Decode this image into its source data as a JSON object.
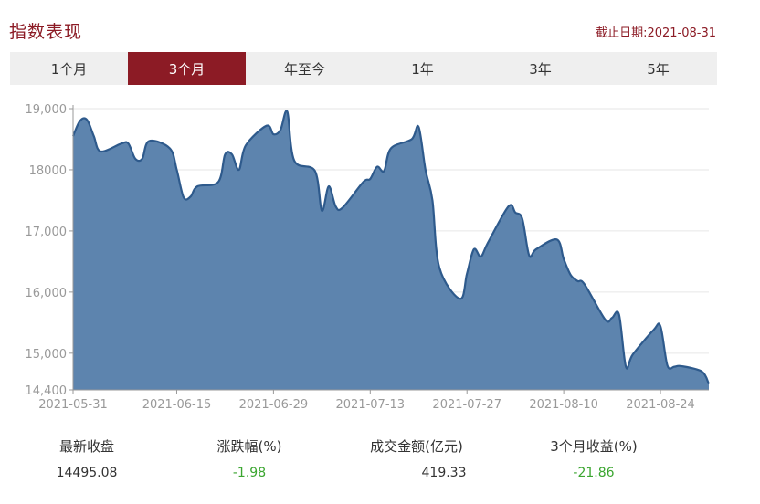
{
  "header": {
    "title": "指数表现",
    "as_of": "截止日期:2021-08-31"
  },
  "tabs": [
    {
      "label": "1个月",
      "active": false
    },
    {
      "label": "3个月",
      "active": true
    },
    {
      "label": "年至今",
      "active": false
    },
    {
      "label": "1年",
      "active": false
    },
    {
      "label": "3年",
      "active": false
    },
    {
      "label": "5年",
      "active": false
    }
  ],
  "chart_data": {
    "type": "area",
    "ylim": [
      14400,
      19000
    ],
    "yticks": [
      19000,
      18000,
      17000,
      16000,
      15000,
      14400
    ],
    "ytick_labels": [
      "19,000",
      "18000",
      "17,000",
      "16,000",
      "15,000",
      "14,400"
    ],
    "xlim": [
      "2021-05-31",
      "2021-08-31"
    ],
    "xticks": [
      "2021-05-31",
      "2021-06-15",
      "2021-06-29",
      "2021-07-13",
      "2021-07-27",
      "2021-08-10",
      "2021-08-24"
    ],
    "grid": true,
    "colors": {
      "line": "#2e5a8c",
      "fill": "#5d84ae",
      "grid": "#e6e6e6",
      "axis": "#999999",
      "label": "#999999"
    },
    "series": [
      {
        "points": [
          [
            "2021-05-31",
            18550
          ],
          [
            "2021-06-01",
            18800
          ],
          [
            "2021-06-02",
            18820
          ],
          [
            "2021-06-03",
            18550
          ],
          [
            "2021-06-04",
            18300
          ],
          [
            "2021-06-07",
            18430
          ],
          [
            "2021-06-08",
            18430
          ],
          [
            "2021-06-09",
            18180
          ],
          [
            "2021-06-10",
            18180
          ],
          [
            "2021-06-11",
            18470
          ],
          [
            "2021-06-14",
            18350
          ],
          [
            "2021-06-15",
            18000
          ],
          [
            "2021-06-16",
            17550
          ],
          [
            "2021-06-17",
            17560
          ],
          [
            "2021-06-18",
            17730
          ],
          [
            "2021-06-21",
            17800
          ],
          [
            "2021-06-22",
            18250
          ],
          [
            "2021-06-23",
            18250
          ],
          [
            "2021-06-24",
            18000
          ],
          [
            "2021-06-25",
            18400
          ],
          [
            "2021-06-28",
            18720
          ],
          [
            "2021-06-29",
            18580
          ],
          [
            "2021-06-30",
            18650
          ],
          [
            "2021-07-01",
            18950
          ],
          [
            "2021-07-02",
            18150
          ],
          [
            "2021-07-05",
            17980
          ],
          [
            "2021-07-06",
            17330
          ],
          [
            "2021-07-07",
            17730
          ],
          [
            "2021-07-08",
            17400
          ],
          [
            "2021-07-09",
            17380
          ],
          [
            "2021-07-12",
            17800
          ],
          [
            "2021-07-13",
            17850
          ],
          [
            "2021-07-14",
            18050
          ],
          [
            "2021-07-15",
            17980
          ],
          [
            "2021-07-16",
            18350
          ],
          [
            "2021-07-19",
            18500
          ],
          [
            "2021-07-20",
            18700
          ],
          [
            "2021-07-21",
            18000
          ],
          [
            "2021-07-22",
            17500
          ],
          [
            "2021-07-23",
            16400
          ],
          [
            "2021-07-26",
            15890
          ],
          [
            "2021-07-27",
            16300
          ],
          [
            "2021-07-28",
            16700
          ],
          [
            "2021-07-29",
            16580
          ],
          [
            "2021-07-30",
            16800
          ],
          [
            "2021-08-02",
            17400
          ],
          [
            "2021-08-03",
            17300
          ],
          [
            "2021-08-04",
            17200
          ],
          [
            "2021-08-05",
            16600
          ],
          [
            "2021-08-06",
            16700
          ],
          [
            "2021-08-09",
            16860
          ],
          [
            "2021-08-10",
            16540
          ],
          [
            "2021-08-11",
            16280
          ],
          [
            "2021-08-12",
            16180
          ],
          [
            "2021-08-13",
            16130
          ],
          [
            "2021-08-16",
            15550
          ],
          [
            "2021-08-17",
            15580
          ],
          [
            "2021-08-18",
            15630
          ],
          [
            "2021-08-19",
            14780
          ],
          [
            "2021-08-20",
            14980
          ],
          [
            "2021-08-23",
            15380
          ],
          [
            "2021-08-24",
            15440
          ],
          [
            "2021-08-25",
            14800
          ],
          [
            "2021-08-26",
            14780
          ],
          [
            "2021-08-27",
            14790
          ],
          [
            "2021-08-30",
            14700
          ],
          [
            "2021-08-31",
            14495
          ]
        ]
      }
    ]
  },
  "stats": [
    {
      "label": "最新收盘",
      "value": "14495.08",
      "color": "#333333"
    },
    {
      "label": "涨跌幅(%)",
      "value": "-1.98",
      "color": "#3ba630"
    },
    {
      "label": "成交金额(亿元)",
      "value": "419.33",
      "color": "#333333"
    },
    {
      "label": "3个月收益(%)",
      "value": "-21.86",
      "color": "#3ba630"
    }
  ]
}
